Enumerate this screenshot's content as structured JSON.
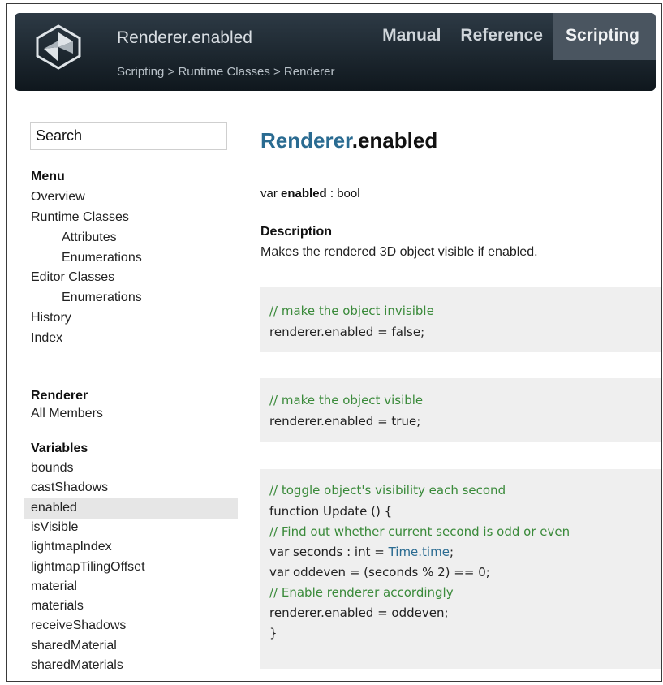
{
  "header": {
    "title": "Renderer.enabled",
    "breadcrumb": "Scripting > Runtime Classes > Renderer",
    "tabs": [
      "Manual",
      "Reference",
      "Scripting"
    ],
    "active_tab": "Scripting"
  },
  "sidebar": {
    "search_value": "Search",
    "menu_heading": "Menu",
    "menu_items": [
      {
        "label": "Overview",
        "indent": false
      },
      {
        "label": "Runtime Classes",
        "indent": false
      },
      {
        "label": "Attributes",
        "indent": true
      },
      {
        "label": "Enumerations",
        "indent": true
      },
      {
        "label": "Editor Classes",
        "indent": false
      },
      {
        "label": "Enumerations",
        "indent": true
      },
      {
        "label": "History",
        "indent": false
      },
      {
        "label": "Index",
        "indent": false
      }
    ],
    "class_heading": "Renderer",
    "class_link": "All Members",
    "variables_heading": "Variables",
    "variables": [
      "bounds",
      "castShadows",
      "enabled",
      "isVisible",
      "lightmapIndex",
      "lightmapTilingOffset",
      "material",
      "materials",
      "receiveShadows",
      "sharedMaterial",
      "sharedMaterials"
    ],
    "selected_variable": "enabled"
  },
  "main": {
    "heading_class": "Renderer",
    "heading_member": ".enabled",
    "signature_prefix": "var ",
    "signature_name": "enabled",
    "signature_type": " : bool",
    "description_heading": "Description",
    "description": "Makes the rendered 3D object visible if enabled.",
    "code_blocks": [
      [
        {
          "text": "// make the object invisible",
          "kind": "comment"
        },
        {
          "text": "renderer.enabled = false;",
          "kind": "code"
        }
      ],
      [
        {
          "text": "// make the object visible",
          "kind": "comment"
        },
        {
          "text": "renderer.enabled = true;",
          "kind": "code"
        }
      ],
      [
        {
          "text": "// toggle object's visibility each second",
          "kind": "comment"
        },
        {
          "text": "function Update () {",
          "kind": "code"
        },
        {
          "text": "// Find out whether current second is odd or even",
          "kind": "comment"
        },
        {
          "text": "var seconds : int = ",
          "kind": "code",
          "ref": "Time.time",
          "after": ";"
        },
        {
          "text": "var oddeven = (seconds % 2) == 0;",
          "kind": "code"
        },
        {
          "text": "// Enable renderer accordingly",
          "kind": "comment"
        },
        {
          "text": "renderer.enabled = oddeven;",
          "kind": "code"
        },
        {
          "text": "}",
          "kind": "code"
        }
      ]
    ]
  },
  "colors": {
    "header_bg": "#1a252e",
    "active_tab_bg": "#4a5560",
    "link_blue": "#2a6b91",
    "comment_green": "#3a8a3a",
    "code_bg": "#efefef",
    "selected_bg": "#e6e6e6"
  },
  "icons": {
    "logo": "unity-logo-icon"
  }
}
